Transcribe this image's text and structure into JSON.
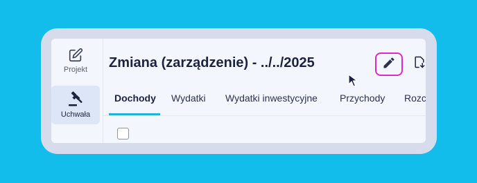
{
  "sidebar": {
    "items": [
      {
        "label": "Projekt",
        "icon": "edit-square-icon"
      },
      {
        "label": "Uchwała",
        "icon": "gavel-icon"
      },
      {
        "label": "",
        "icon": "chart-icon"
      }
    ]
  },
  "header": {
    "title": "Zmiana (zarządzenie) - ../../2025",
    "tools": [
      "pencil-icon",
      "file-download-icon",
      "cloud-check-icon"
    ]
  },
  "tabs": [
    {
      "label": "Dochody",
      "active": true
    },
    {
      "label": "Wydatki"
    },
    {
      "label": "Wydatki inwestycyjne"
    },
    {
      "label": "Przychody"
    },
    {
      "label": "Rozc"
    }
  ],
  "colors": {
    "background": "#12bdec",
    "accent": "#1fb3d8",
    "focus_ring": "#e028c8",
    "text": "#1c2340"
  }
}
